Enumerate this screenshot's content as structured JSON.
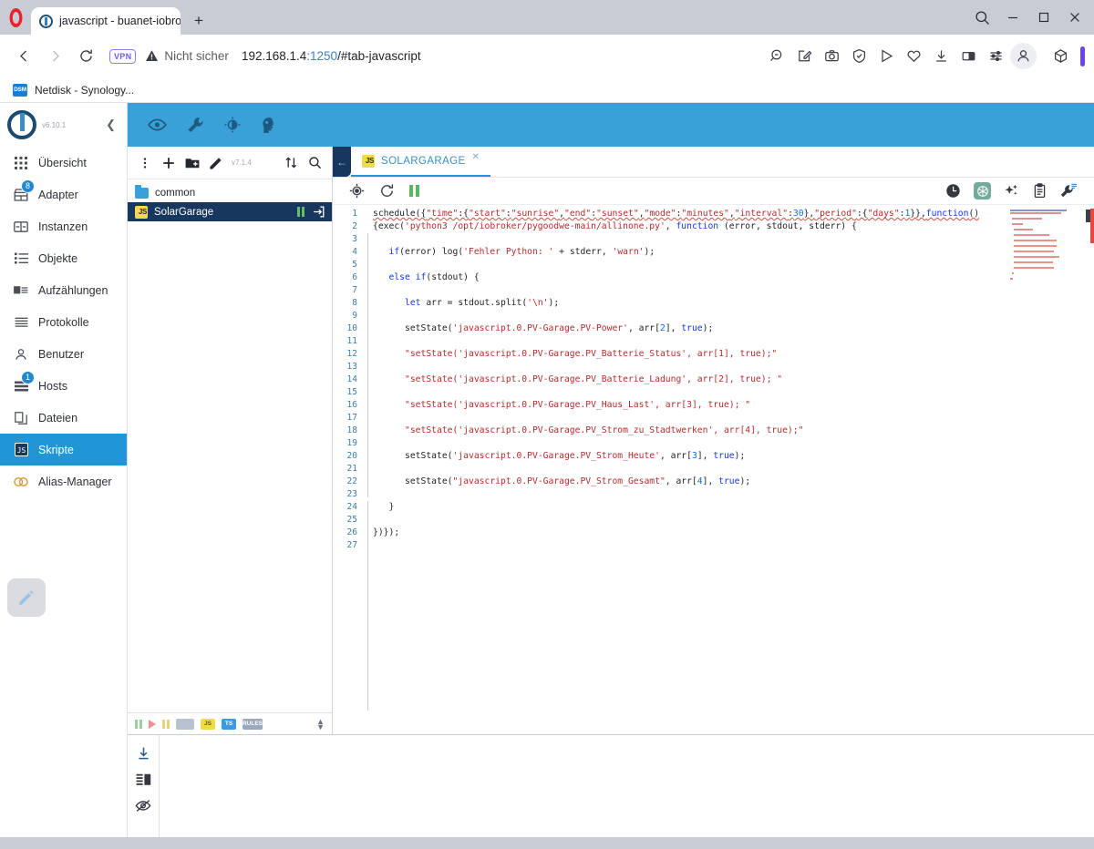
{
  "browser": {
    "tab": {
      "title": "javascript - buanet-iobrok",
      "favicon": "iobroker-icon"
    },
    "new_tab_label": "+",
    "window_controls": [
      "search-icon",
      "minimize-icon",
      "maximize-icon",
      "close-icon"
    ],
    "nav": {
      "back": "back-icon",
      "forward": "forward-icon",
      "reload": "reload-icon",
      "vpn_badge": "VPN",
      "security_text": "Nicht sicher",
      "url_host": "192.168.1.4",
      "url_port": ":1250",
      "url_path": "/#tab-javascript"
    },
    "toolbar_icons": [
      "zoom-out-icon",
      "edit-note-icon",
      "snapshot-icon",
      "shield-check-icon",
      "send-icon",
      "heart-icon",
      "download-icon",
      "sidebar-toggle-icon",
      "easy-setup-icon",
      "profile-icon",
      "extensions-cube-icon"
    ],
    "bookmarks": [
      {
        "label": "Netdisk - Synology...",
        "icon_text": "DSM"
      }
    ]
  },
  "sidebar": {
    "version": "v6.10.1",
    "collapse_icon": "chevron-left-icon",
    "items": [
      {
        "label": "Übersicht",
        "icon": "grid-icon",
        "badge": null
      },
      {
        "label": "Adapter",
        "icon": "store-icon",
        "badge": "8"
      },
      {
        "label": "Instanzen",
        "icon": "instances-icon",
        "badge": null
      },
      {
        "label": "Objekte",
        "icon": "list-icon",
        "badge": null
      },
      {
        "label": "Aufzählungen",
        "icon": "enum-icon",
        "badge": null
      },
      {
        "label": "Protokolle",
        "icon": "log-icon",
        "badge": null
      },
      {
        "label": "Benutzer",
        "icon": "user-icon",
        "badge": null
      },
      {
        "label": "Hosts",
        "icon": "hosts-icon",
        "badge": "1"
      },
      {
        "label": "Dateien",
        "icon": "files-icon",
        "badge": null
      },
      {
        "label": "Skripte",
        "icon": "js-icon",
        "badge": null,
        "active": true
      },
      {
        "label": "Alias-Manager",
        "icon": "alias-icon",
        "badge": null
      }
    ],
    "fab": "edit-pencil-icon"
  },
  "app_header": {
    "icons": [
      "eye-icon",
      "wrench-icon",
      "contrast-icon",
      "expert-mode-icon"
    ],
    "color": "#3aa0d8"
  },
  "scripts_panel": {
    "toolbar": {
      "more_icon": "more-vertical-icon",
      "add_icon": "add-icon",
      "add_folder_icon": "add-folder-icon",
      "edit_icon": "edit-pencil-icon",
      "version": "v7.1.4",
      "sort_icon": "sort-icon",
      "search_icon": "search-icon"
    },
    "rows": [
      {
        "label": "common",
        "type": "folder",
        "selected": false
      },
      {
        "label": "SolarGarage",
        "type": "script",
        "selected": true,
        "actions": [
          "pause-icon",
          "export-icon"
        ]
      }
    ],
    "statusbar": {
      "icons": [
        "pause-green-icon",
        "play-red-icon",
        "pause-yellow-icon",
        "debug-chip",
        "js-chip",
        "ts-chip",
        "rules-chip"
      ],
      "chips": [
        {
          "text": "JS",
          "color": "#f0db4f"
        },
        {
          "text": "TS",
          "color": "#3d9ae0"
        },
        {
          "text": "RULES",
          "color": "#9aa8bd"
        }
      ],
      "stepper_icon": "stepper-updown-icon"
    }
  },
  "editor": {
    "back_icon": "arrow-left-icon",
    "tab": {
      "label": "SOLARGARAGE",
      "icon_text": "JS",
      "close_icon": "close-icon"
    },
    "toolbar_left": [
      "locate-icon",
      "restart-icon",
      "pause-icon"
    ],
    "toolbar_right": [
      "clock-icon",
      "chatgpt-icon",
      "sparkle-icon",
      "clipboard-icon",
      "wrench-config-icon"
    ],
    "code_lines": [
      {
        "n": 1,
        "text": "schedule({\"time\":{\"start\":\"sunrise\",\"end\":\"sunset\",\"mode\":\"minutes\",\"interval\":30},\"period\":{\"days\":1}},function()"
      },
      {
        "n": 2,
        "text": "{exec('python3 /opt/iobroker/pygoodwe-main/allinone.py', function (error, stdout, stderr) {"
      },
      {
        "n": 3,
        "text": ""
      },
      {
        "n": 4,
        "text": "   if(error) log('Fehler Python: ' + stderr, 'warn');"
      },
      {
        "n": 5,
        "text": ""
      },
      {
        "n": 6,
        "text": "   else if(stdout) {"
      },
      {
        "n": 7,
        "text": ""
      },
      {
        "n": 8,
        "text": "      let arr = stdout.split('\\n');"
      },
      {
        "n": 9,
        "text": ""
      },
      {
        "n": 10,
        "text": "      setState('javascript.0.PV-Garage.PV-Power', arr[2], true);"
      },
      {
        "n": 11,
        "text": ""
      },
      {
        "n": 12,
        "text": "      \"setState('javascript.0.PV-Garage.PV_Batterie_Status', arr[1], true);\""
      },
      {
        "n": 13,
        "text": ""
      },
      {
        "n": 14,
        "text": "      \"setState('javascript.0.PV-Garage.PV_Batterie_Ladung', arr[2], true); \""
      },
      {
        "n": 15,
        "text": ""
      },
      {
        "n": 16,
        "text": "      \"setState('javascript.0.PV-Garage.PV_Haus_Last', arr[3], true); \""
      },
      {
        "n": 17,
        "text": ""
      },
      {
        "n": 18,
        "text": "      \"setState('javascript.0.PV-Garage.PV_Strom_zu_Stadtwerken', arr[4], true);\""
      },
      {
        "n": 19,
        "text": ""
      },
      {
        "n": 20,
        "text": "      setState('javascript.0.PV-Garage.PV_Strom_Heute', arr[3], true);"
      },
      {
        "n": 21,
        "text": ""
      },
      {
        "n": 22,
        "text": "      setState(\"javascript.0.PV-Garage.PV_Strom_Gesamt\", arr[4], true);"
      },
      {
        "n": 23,
        "text": ""
      },
      {
        "n": 24,
        "text": "   }"
      },
      {
        "n": 25,
        "text": ""
      },
      {
        "n": 26,
        "text": "})});"
      },
      {
        "n": 27,
        "text": ""
      }
    ]
  },
  "output_panel": {
    "rail_icons": [
      "scroll-to-bottom-icon",
      "layout-icon",
      "hide-eye-icon"
    ],
    "content": ""
  }
}
